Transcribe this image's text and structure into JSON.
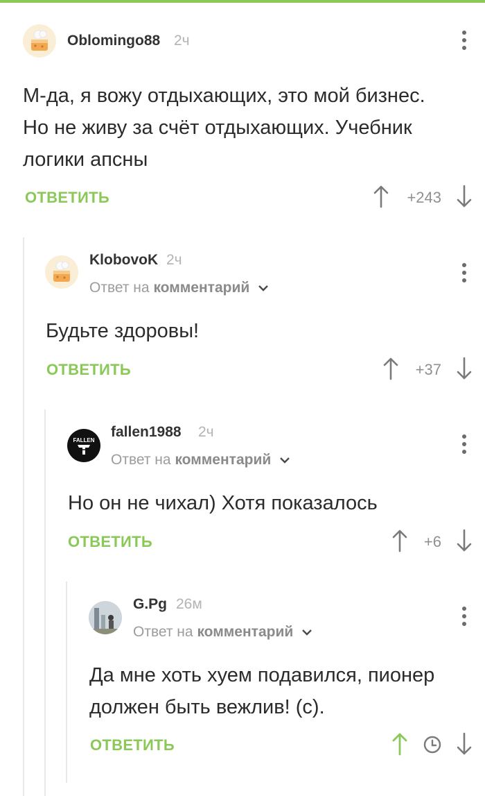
{
  "colors": {
    "accent": "#8ac858",
    "text": "#2b2b2b",
    "muted": "#9c9c9c"
  },
  "comments": [
    {
      "username": "Oblomingo88",
      "time": "2ч",
      "avatar": "cake-avatar",
      "text_lines": [
        "М-да, я вожу отдыхающих, это мой бизнес.",
        "Но не живу за счёт отдыхающих. Учебник",
        "логики апсны"
      ],
      "reply_label": "ОТВЕТИТЬ",
      "rating": "+243"
    },
    {
      "username": "KlobovoK",
      "time": "2ч",
      "avatar": "cake-avatar",
      "reply_to_prefix": "Ответ на",
      "reply_to_target": "комментарий",
      "text_lines": [
        "Будьте здоровы!"
      ],
      "reply_label": "ОТВЕТИТЬ",
      "rating": "+37"
    },
    {
      "username": "fallen1988",
      "time": "2ч",
      "avatar": "fallen-logo-avatar",
      "avatar_text": "FALLEN",
      "reply_to_prefix": "Ответ на",
      "reply_to_target": "комментарий",
      "text_lines": [
        "Но он не чихал) Хотя показалось"
      ],
      "reply_label": "ОТВЕТИТЬ",
      "rating": "+6"
    },
    {
      "username": "G.Pg",
      "time": "26м",
      "avatar": "photo-avatar",
      "reply_to_prefix": "Ответ на",
      "reply_to_target": "комментарий",
      "text_lines": [
        "Да мне хоть хуем подавился, пионер",
        "должен быть вежлив! (с)."
      ],
      "reply_label": "ОТВЕТИТЬ",
      "rating_icon": "clock-icon"
    }
  ]
}
